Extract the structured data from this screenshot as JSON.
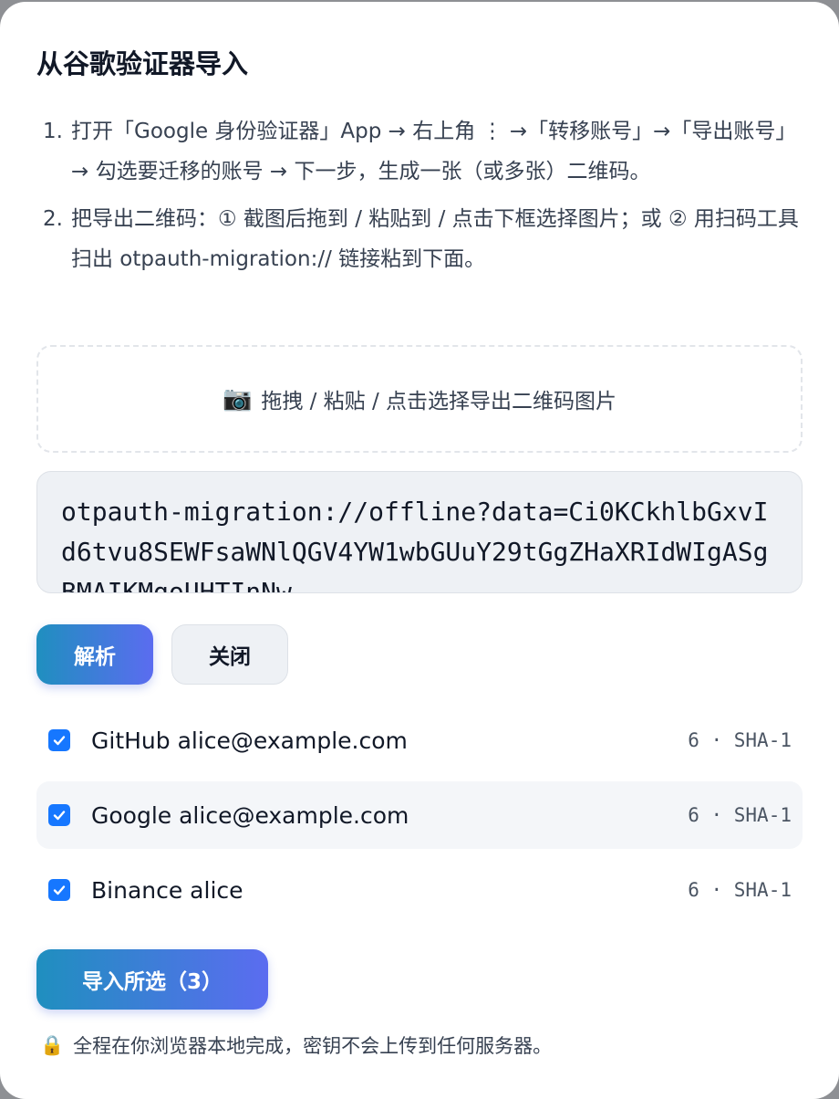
{
  "dialog": {
    "title": "从谷歌验证器导入",
    "steps": [
      {
        "num": "1.",
        "text": "打开「Google 身份验证器」App → 右上角 ⋮ →「转移账号」→「导出账号」→ 勾选要迁移的账号 → 下一步，生成一张（或多张）二维码。"
      },
      {
        "num": "2.",
        "text": "把导出二维码：① 截图后拖到 / 粘贴到 / 点击下框选择图片；或 ② 用扫码工具扫出 otpauth-migration:// 链接粘到下面。"
      }
    ],
    "dropzone": {
      "icon": "camera-icon",
      "label": "拖拽 / 粘贴 / 点击选择导出二维码图片"
    },
    "uri_input": {
      "value": "otpauth-migration://offline?data=Ci0KCkhlbGxvId6tvu8SEWFsaWNlQGV4YW1wbGUuY29tGgZHaXRIdWIgASgBMAIKMgoUHTInNw"
    },
    "buttons": {
      "parse": "解析",
      "close": "关闭",
      "import": "导入所选（3）"
    },
    "accounts": [
      {
        "name": "GitHub alice@example.com",
        "meta": "6 · SHA-1",
        "checked": true
      },
      {
        "name": "Google alice@example.com",
        "meta": "6 · SHA-1",
        "checked": true
      },
      {
        "name": "Binance alice",
        "meta": "6 · SHA-1",
        "checked": true
      }
    ],
    "footnote": {
      "icon": "lock-icon",
      "text": "全程在你浏览器本地完成，密钥不会上传到任何服务器。"
    }
  },
  "colors": {
    "accent_start": "#1f8fbf",
    "accent_end": "#5b6cf0",
    "checkbox": "#1677ff"
  }
}
